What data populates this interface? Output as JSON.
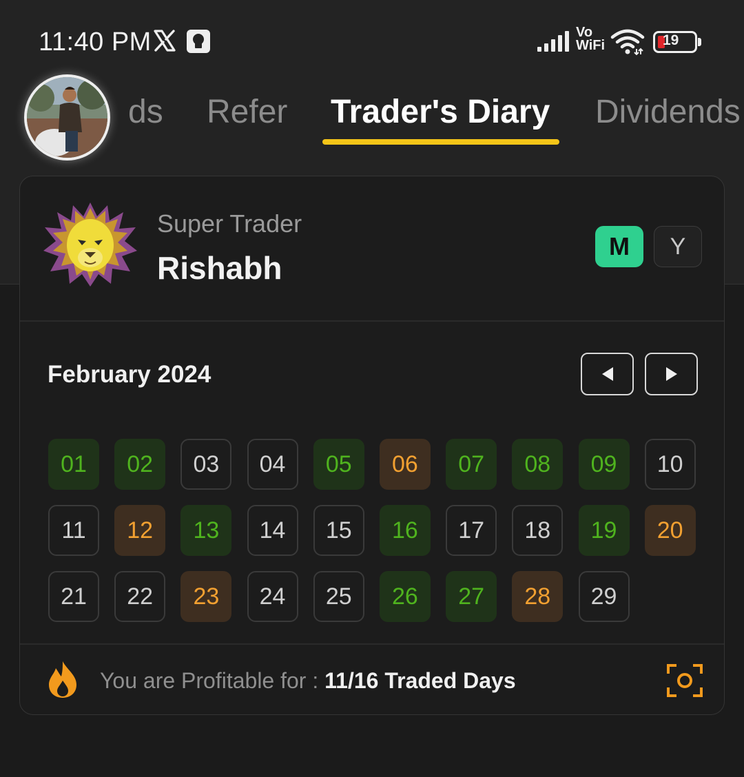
{
  "status_bar": {
    "time": "11:40 PM",
    "network_label_top": "Vo",
    "network_label_bottom": "WiFi",
    "battery_level": "19",
    "icons": [
      "x-icon",
      "bulb-icon",
      "signal-icon",
      "wifi-icon",
      "battery-icon"
    ]
  },
  "tabs": [
    {
      "label": "ds",
      "active": false
    },
    {
      "label": "Refer",
      "active": false
    },
    {
      "label": "Trader's Diary",
      "active": true
    },
    {
      "label": "Dividends",
      "active": false
    }
  ],
  "colors": {
    "accent_underline": "#f5c518",
    "toggle_active": "#2fd08f",
    "profit_text": "#4fb31e",
    "profit_bg": "#1f3319",
    "loss_text": "#f2a031",
    "loss_bg": "#3e2e20",
    "icon_orange": "#f29a1d"
  },
  "profile": {
    "rank": "Super Trader",
    "name": "Rishabh",
    "toggle_month": "M",
    "toggle_year": "Y",
    "selected_toggle": "M"
  },
  "calendar": {
    "month": "February 2024",
    "days": [
      {
        "label": "01",
        "status": "profit"
      },
      {
        "label": "02",
        "status": "profit"
      },
      {
        "label": "03",
        "status": "none"
      },
      {
        "label": "04",
        "status": "none"
      },
      {
        "label": "05",
        "status": "profit"
      },
      {
        "label": "06",
        "status": "loss"
      },
      {
        "label": "07",
        "status": "profit"
      },
      {
        "label": "08",
        "status": "profit"
      },
      {
        "label": "09",
        "status": "profit"
      },
      {
        "label": "10",
        "status": "none"
      },
      {
        "label": "11",
        "status": "none"
      },
      {
        "label": "12",
        "status": "loss"
      },
      {
        "label": "13",
        "status": "profit"
      },
      {
        "label": "14",
        "status": "none"
      },
      {
        "label": "15",
        "status": "none"
      },
      {
        "label": "16",
        "status": "profit"
      },
      {
        "label": "17",
        "status": "none"
      },
      {
        "label": "18",
        "status": "none"
      },
      {
        "label": "19",
        "status": "profit"
      },
      {
        "label": "20",
        "status": "loss"
      },
      {
        "label": "21",
        "status": "none"
      },
      {
        "label": "22",
        "status": "none"
      },
      {
        "label": "23",
        "status": "loss"
      },
      {
        "label": "24",
        "status": "none"
      },
      {
        "label": "25",
        "status": "none"
      },
      {
        "label": "26",
        "status": "profit"
      },
      {
        "label": "27",
        "status": "profit"
      },
      {
        "label": "28",
        "status": "loss"
      },
      {
        "label": "29",
        "status": "none"
      }
    ]
  },
  "summary": {
    "prefix": "You are Profitable for : ",
    "value": "11/16 Traded Days"
  }
}
